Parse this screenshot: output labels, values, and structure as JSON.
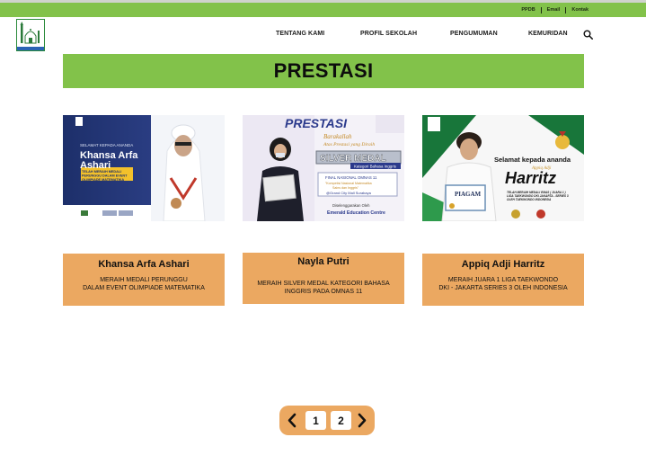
{
  "top_bar": {
    "links": [
      "PPDB",
      "Email",
      "Kontak"
    ]
  },
  "header": {
    "logo_icon": "school-mosque-logo",
    "nav": [
      "TENTANG KAMI",
      "PROFIL SEKOLAH",
      "PENGUMUMAN",
      "KEMURIDAN"
    ],
    "search_icon": "search-icon"
  },
  "banner": {
    "title": "PRESTASI"
  },
  "photos": [
    {
      "greeting": "SELAMAT KEPADA ANANDA",
      "name_line1": "Khansa Arfa",
      "name_line2": "Ashari",
      "achievement_line1": "TELAH MERAIH MEDALI",
      "achievement_line2": "PERUNGGU DALAM EVENT",
      "achievement_line3": "OLIMPIADE MATEMATIKA"
    },
    {
      "title": "PRESTASI",
      "greeting_line1": "Barakallah",
      "greeting_line2": "Atas Prestasi yang Diraih",
      "medal": "SILVER MEDAL",
      "category": "Kategori Bahasa Inggris",
      "event_line1": "FINAL NASIONAL OMNAS 11",
      "event_line2": "\"Kompetisi Nasional Matematika",
      "event_line3": "Sains dan Inggris\"",
      "venue": "@Grand City Mall Surabaya",
      "organizer_label": "Diselenggarakan Oleh",
      "organizer": "Emerald Education Centre"
    },
    {
      "greeting": "Selamat kepada ananda",
      "first_name": "Appiq Adji",
      "last_name": "Harritz",
      "certificate": "PIAGAM",
      "achievement_line1": "TELAH MERAIH MEDALI EMAS ( JUARA 1 )",
      "achievement_line2": "LIGA TAEKWONDO DKI JAKARTA - SERIES 3",
      "achievement_line3": "OLEH TAEKWONDO INDONESIA"
    }
  ],
  "captions": [
    {
      "name": "Khansa Arfa Ashari",
      "description": "MERAIH MEDALI PERUNGGU\nDALAM EVENT OLIMPIADE MATEMATIKA"
    },
    {
      "name": "Nayla Putri",
      "description": "MERAIH SILVER MEDAL KATEGORI BAHASA\nINGGRIS PADA OMNAS 11"
    },
    {
      "name": "Appiq Adji Harritz",
      "description": "MERAIH JUARA 1 LIGA TAEKWONDO\nDKI - JAKARTA SERIES 3 OLEH INDONESIA"
    }
  ],
  "pagination": {
    "prev_icon": "chevron-left-icon",
    "next_icon": "chevron-right-icon",
    "pages": [
      "1",
      "2"
    ]
  },
  "colors": {
    "brand_green": "#82c24a",
    "accent_orange": "#eba861"
  }
}
